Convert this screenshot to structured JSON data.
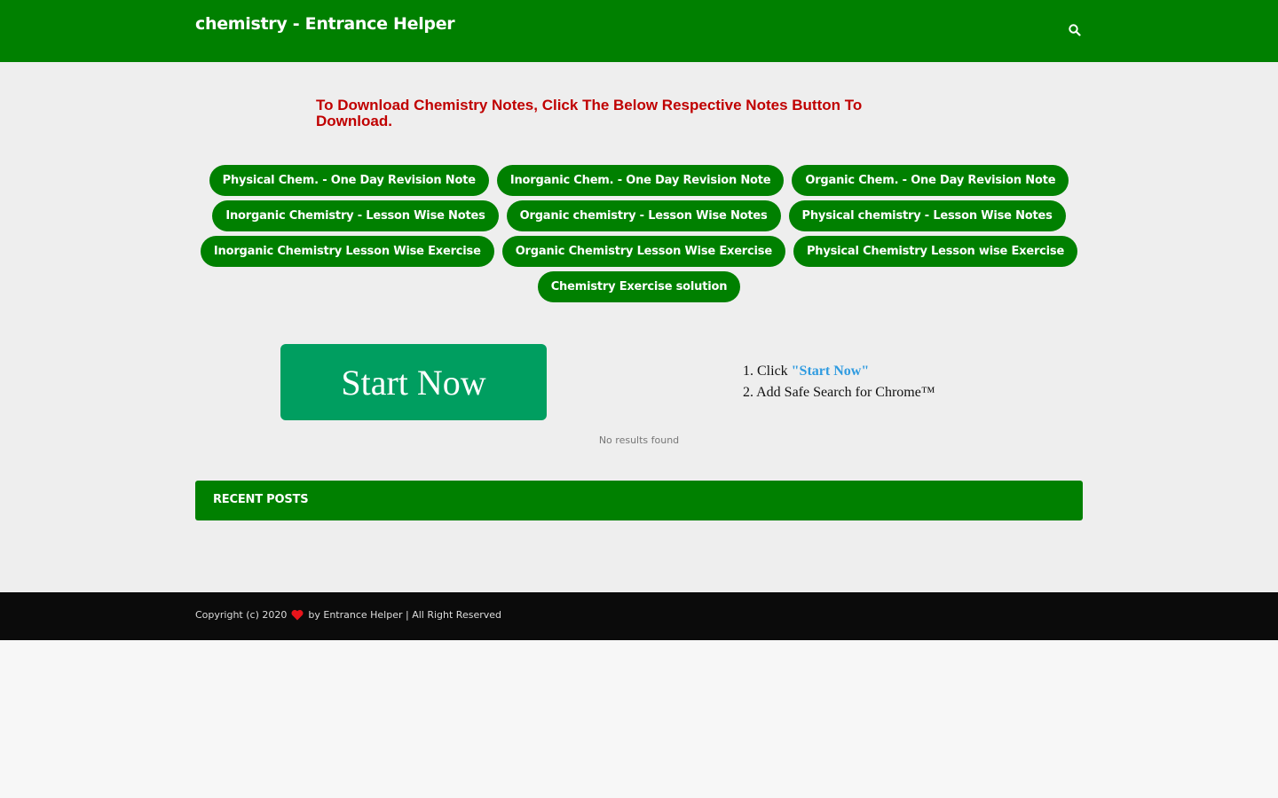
{
  "header": {
    "site_title": "chemistry - Entrance Helper",
    "search_icon": "search-icon"
  },
  "notice": "To Download Chemistry Notes, Click The Below Respective Notes Button To Download.",
  "note_buttons": {
    "row1": [
      "Physical Chem. - One Day Revision Note",
      "Inorganic Chem. - One Day Revision Note",
      "Organic Chem. - One Day Revision Note"
    ],
    "row2": [
      "Inorganic Chemistry - Lesson Wise Notes",
      "Organic chemistry - Lesson Wise Notes",
      "Physical chemistry - Lesson Wise Notes"
    ],
    "row3": [
      "Inorganic Chemistry Lesson Wise Exercise",
      "Organic Chemistry Lesson Wise Exercise",
      "Physical Chemistry Lesson wise Exercise"
    ],
    "row4": [
      "Chemistry Exercise solution"
    ]
  },
  "ad": {
    "start_button": "Start Now",
    "step1_prefix": "1. Click ",
    "step1_accent": "\"Start Now\"",
    "step2": "2. Add Safe Search for Chrome™"
  },
  "no_results": "No results found",
  "recent_posts": {
    "title": "RECENT POSTS"
  },
  "footer": {
    "copyright": "Copyright (c) 2020",
    "heart_icon": "heart-icon",
    "credit": "by Entrance Helper | All Right Reserved"
  },
  "colors": {
    "brand_green": "#008000",
    "notice_red": "#c00000",
    "start_green": "#009e60",
    "accent_blue": "#2f9be0",
    "footer_bg": "#0b0b0b"
  }
}
